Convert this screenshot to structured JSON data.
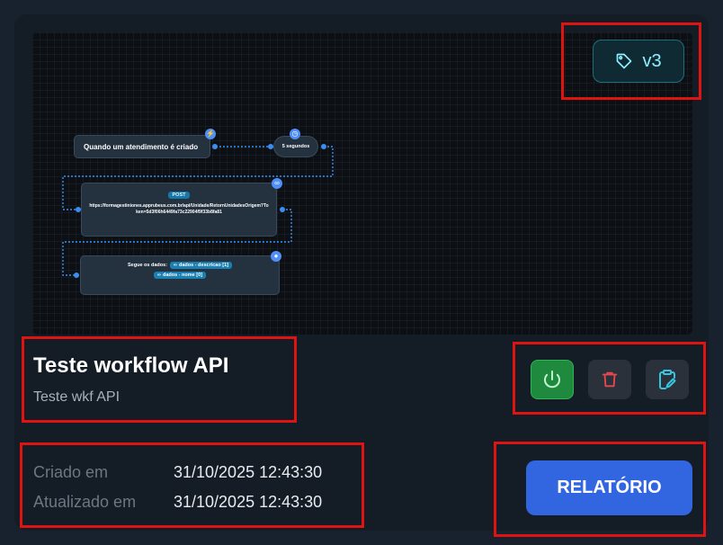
{
  "workflow": {
    "version": "v3",
    "title": "Teste workflow API",
    "description": "Teste wkf API",
    "created_label": "Criado em",
    "created_value": "31/10/2025 12:43:30",
    "updated_label": "Atualizado em",
    "updated_value": "31/10/2025 12:43:30"
  },
  "flow": {
    "trigger_label": "Quando um atendimento é criado",
    "delay_label": "5 segundos",
    "http_method": "POST",
    "http_url": "https://formagestiniones.apprubeus.com.br/api/Unidade/RetornUnidadesOrigem?Token=5d3f06h6449fa73c22904f9f33b8fa81",
    "message_label": "Segue os dados:",
    "var_1": "dados - descricao [1]",
    "var_2": "dados - nome [0]"
  },
  "actions": {
    "report_label": "RELATÓRIO"
  },
  "colors": {
    "power": "#1f8a3e",
    "delete": "#e5484d",
    "edit": "#36c5e0",
    "report": "#3266e0",
    "badge": "#8ef0ff",
    "annotation": "#e01313"
  }
}
